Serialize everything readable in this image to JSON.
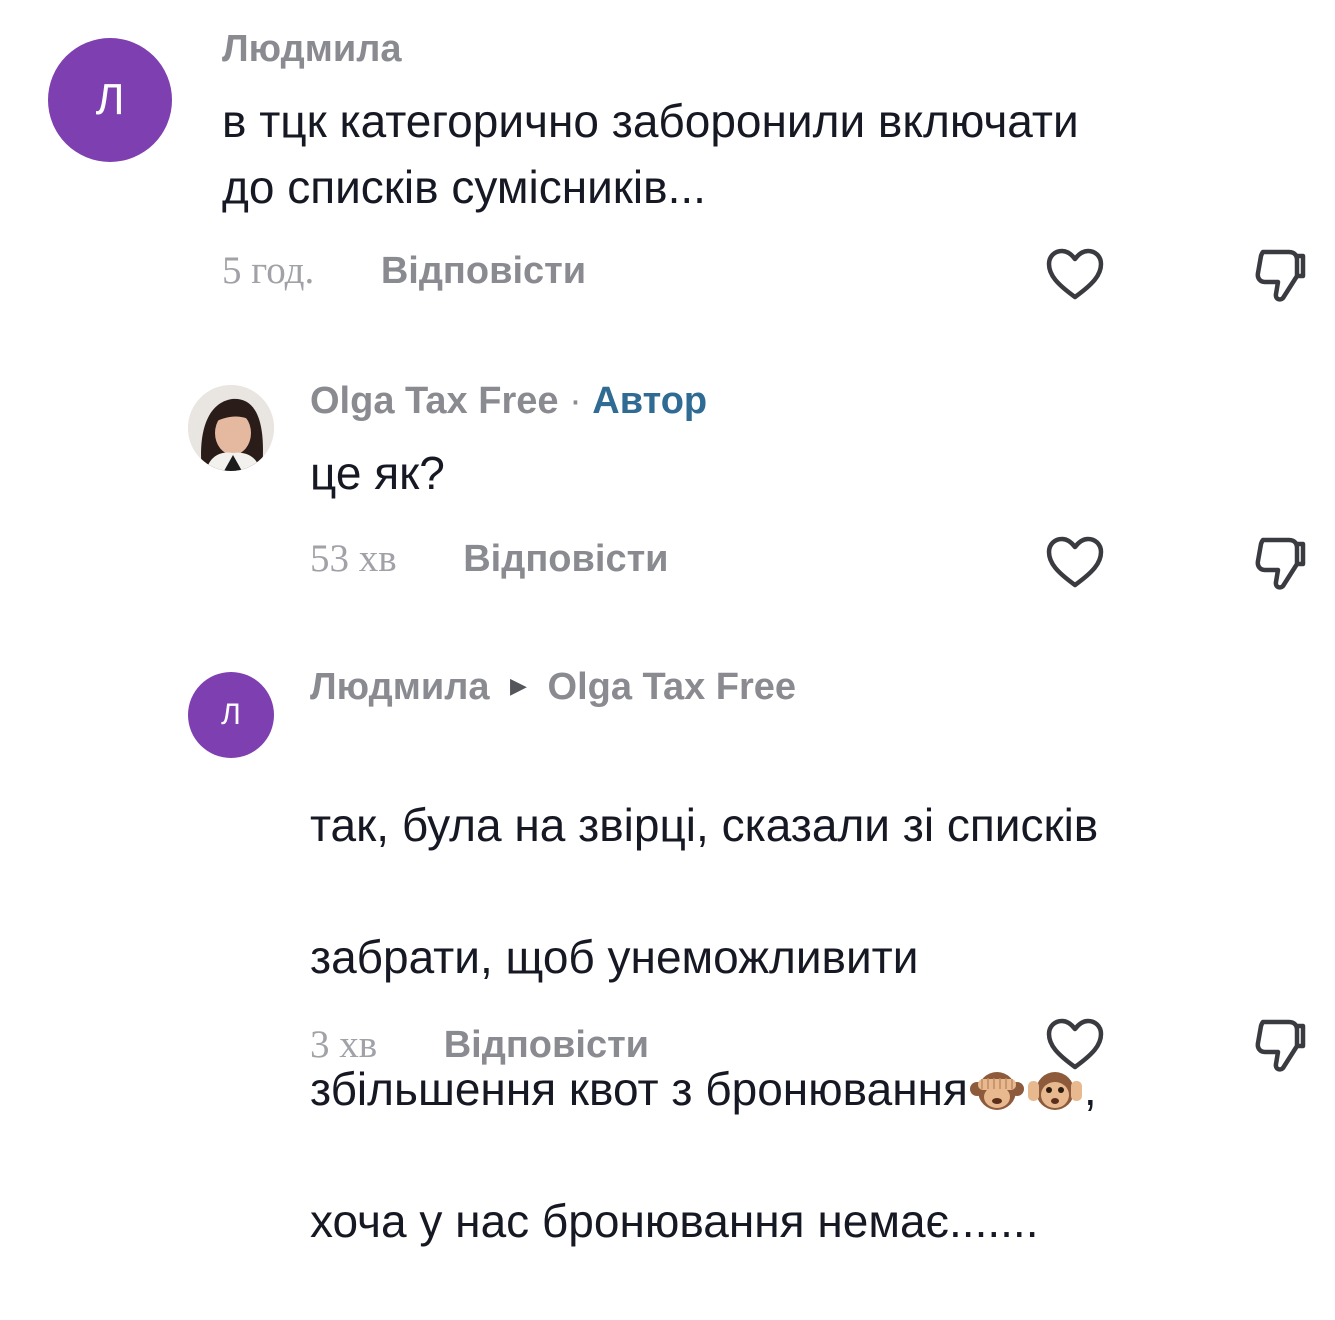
{
  "comments": [
    {
      "avatar_letter": "Л",
      "author": "Людмила",
      "text": "в тцк категорично заборонили включати\nдо списків сумісників...",
      "time": "5 год.",
      "reply_label": "Відповісти"
    },
    {
      "author": "Olga Tax Free",
      "separator": "·",
      "badge": "Автор",
      "text": "це як?",
      "time": "53 хв",
      "reply_label": "Відповісти"
    },
    {
      "avatar_letter": "Л",
      "author": "Людмила",
      "reply_to": "Olga Tax Free",
      "text_lines": [
        "так, була на звірці, сказали зі списків",
        "забрати, щоб унеможливити",
        "збільшення квот з бронювання",
        ",",
        "хоча у нас бронювання немає......."
      ],
      "emojis": [
        "see-no-evil-monkey",
        "hear-no-evil-monkey"
      ],
      "time": "3 хв",
      "reply_label": "Відповісти"
    }
  ],
  "icons": {
    "like": "heart-outline-icon",
    "dislike": "thumbs-down-outline-icon"
  },
  "colors": {
    "avatar": "#7e3fb1",
    "badge": "#2f6b93",
    "muted": "#8a8b91"
  }
}
